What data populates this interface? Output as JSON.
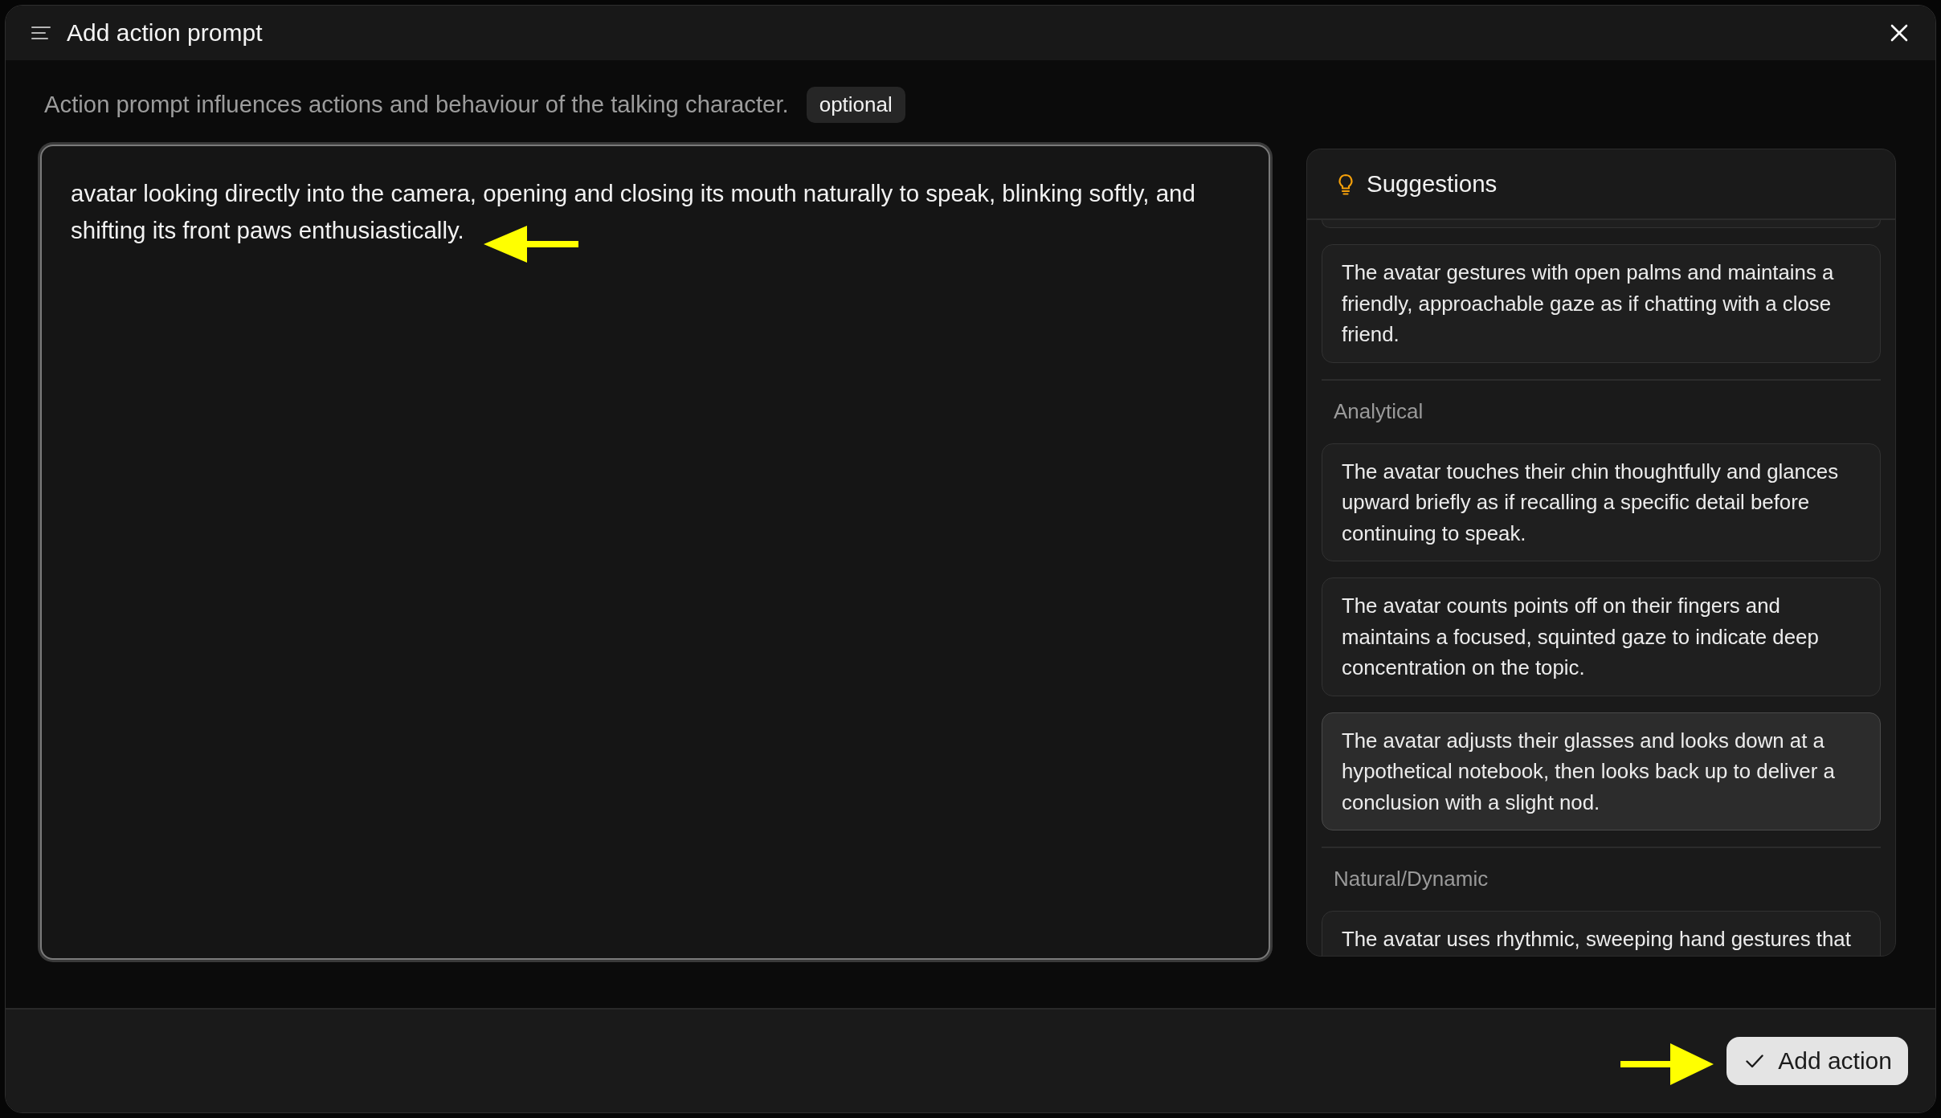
{
  "window": {
    "title": "Add action prompt"
  },
  "description": {
    "text": "Action prompt influences actions and behaviour of the talking character.",
    "badge": "optional"
  },
  "prompt_field": {
    "value": "avatar looking directly into the camera, opening and closing its mouth naturally to speak, blinking softly, and shifting its front paws enthusiastically."
  },
  "suggestions": {
    "title": "Suggestions",
    "groups": [
      {
        "items": [
          {
            "text": "The avatar gestures with open palms and maintains a friendly, approachable gaze as if chatting with a close friend.",
            "hovered": false
          }
        ]
      },
      {
        "heading": "Analytical",
        "items": [
          {
            "text": "The avatar touches their chin thoughtfully and glances upward briefly as if recalling a specific detail before continuing to speak.",
            "hovered": false
          },
          {
            "text": "The avatar counts points off on their fingers and maintains a focused, squinted gaze to indicate deep concentration on the topic.",
            "hovered": false
          },
          {
            "text": "The avatar adjusts their glasses and looks down at a hypothetical notebook, then looks back up to deliver a conclusion with a slight nod.",
            "hovered": true
          }
        ]
      },
      {
        "heading": "Natural/Dynamic",
        "items": [
          {
            "text": "The avatar uses rhythmic, sweeping hand gestures that",
            "hovered": false
          }
        ]
      }
    ]
  },
  "footer": {
    "button": "Add action"
  }
}
